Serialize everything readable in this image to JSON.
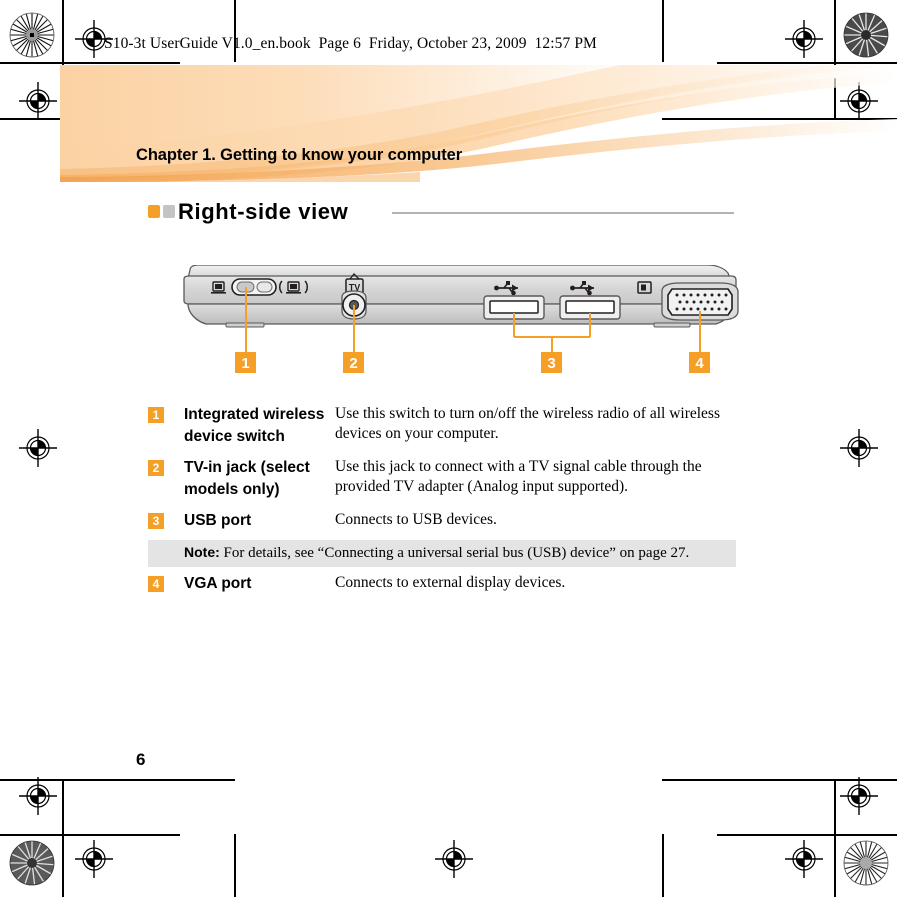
{
  "book_header": "S10-3t UserGuide V1.0_en.book  Page 6  Friday, October 23, 2009  12:57 PM",
  "chapter_title": "Chapter 1. Getting to know your computer",
  "section": {
    "title": "Right-side view",
    "marker_orange": "#f59f26",
    "marker_gray": "#c4c4c4",
    "rule_color": "#b3b3b3"
  },
  "diagram": {
    "alt": "Right-side view of notebook computer chassis",
    "callouts": [
      {
        "number": "1",
        "target": "integrated-wireless-device-switch"
      },
      {
        "number": "2",
        "target": "tv-in-jack"
      },
      {
        "number": "3",
        "target": "usb-ports"
      },
      {
        "number": "4",
        "target": "vga-port"
      }
    ],
    "icons": {
      "wireless_off": "monitor-icon",
      "wireless_on": "wireless-signal-icon",
      "tv_in": "tv-icon",
      "usb": "usb-trident-icon",
      "vga": "display-icon"
    }
  },
  "table": {
    "rows": [
      {
        "number": "1",
        "term": "Integrated wireless device switch",
        "detail": "Use this switch to turn on/off the wireless radio of all wireless devices on your computer."
      },
      {
        "number": "2",
        "term": "TV-in jack (select models only)",
        "detail": "Use this jack to connect with a TV signal cable through the provided TV adapter (Analog input supported)."
      },
      {
        "number": "3",
        "term": "USB port",
        "detail": "Connects to USB devices."
      },
      {
        "number": "4",
        "term": "VGA port",
        "detail": "Connects to external display devices."
      }
    ],
    "note": {
      "label": "Note:",
      "text": "For details, see “Connecting a universal serial bus (USB) device” on page 27."
    }
  },
  "page_number": "6",
  "colors": {
    "accent_orange": "#f59f26",
    "banner_peach": "#fbd3a5",
    "note_gray": "#e4e4e4",
    "chassis_gray": "#d9d9d9"
  }
}
